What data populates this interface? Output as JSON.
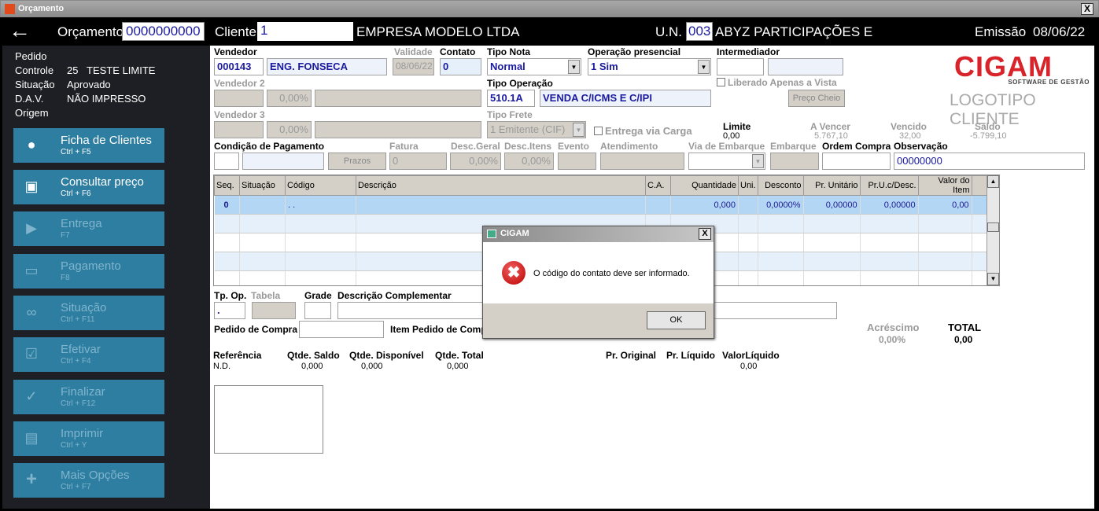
{
  "window": {
    "title": "Orçamento",
    "close": "X"
  },
  "header": {
    "orcamento_label": "Orçamento",
    "orcamento_value": "0000000000",
    "cliente_label": "Cliente",
    "cliente_value": "1",
    "cliente_name": "EMPRESA MODELO LTDA",
    "un_label": "U.N.",
    "un_value": "003",
    "un_name": "ABYZ PARTICIPAÇÕES E",
    "emissao_label": "Emissão",
    "emissao_value": "08/06/22"
  },
  "info": {
    "pedido_label": "Pedido",
    "controle_label": "Controle",
    "controle_value": "25   TESTE LIMITE",
    "situacao_label": "Situação",
    "situacao_value": "Aprovado",
    "dav_label": "D.A.V.",
    "dav_value": "NÃO IMPRESSO",
    "origem_label": "Origem"
  },
  "sidebar": {
    "buttons": [
      {
        "label": "Ficha de Clientes",
        "shortcut": "Ctrl + F5",
        "icon": "users-icon",
        "enabled": true
      },
      {
        "label": "Consultar preço",
        "shortcut": "Ctrl + F6",
        "icon": "price-search-icon",
        "enabled": true
      },
      {
        "label": "Entrega",
        "shortcut": "F7",
        "icon": "truck-icon",
        "enabled": false
      },
      {
        "label": "Pagamento",
        "shortcut": "F8",
        "icon": "money-icon",
        "enabled": false
      },
      {
        "label": "Situação",
        "shortcut": "Ctrl + F11",
        "icon": "link-icon",
        "enabled": false
      },
      {
        "label": "Efetivar",
        "shortcut": "Ctrl + F4",
        "icon": "document-check-icon",
        "enabled": false
      },
      {
        "label": "Finalizar",
        "shortcut": "Ctrl + F12",
        "icon": "checkmark-icon",
        "enabled": false
      },
      {
        "label": "Imprimir",
        "shortcut": "Ctrl + Y",
        "icon": "printer-icon",
        "enabled": false
      },
      {
        "label": "Mais Opções",
        "shortcut": "Ctrl + F7",
        "icon": "plus-icon",
        "enabled": false
      }
    ]
  },
  "form": {
    "vendedor_label": "Vendedor",
    "vendedor_code": "000143",
    "vendedor_name": "ENG. FONSECA",
    "validade_label": "Validade",
    "validade_value": "08/06/22",
    "contato_label": "Contato",
    "contato_value": "0",
    "tipo_nota_label": "Tipo Nota",
    "tipo_nota_value": "Normal",
    "op_presencial_label": "Operação presencial",
    "op_presencial_value": "1 Sim",
    "intermediador_label": "Intermediador",
    "liberado_label": "Liberado Apenas a Vista",
    "preco_cheio": "Preço Cheio",
    "vendedor2_label": "Vendedor 2",
    "vendedor2_pct": "0,00%",
    "vendedor3_label": "Vendedor 3",
    "vendedor3_pct": "0,00%",
    "tipo_operacao_label": "Tipo Operação",
    "tipo_operacao_code": "510.1A",
    "tipo_operacao_desc": "VENDA C/ICMS E C/IPI",
    "tipo_frete_label": "Tipo Frete",
    "tipo_frete_value": "1 Emitente (CIF)",
    "entrega_carga_label": "Entrega via Carga",
    "limite_label": "Limite",
    "limite_value": "0,00",
    "a_vencer_label": "A Vencer",
    "a_vencer_value": "5.767,10",
    "vencido_label": "Vencido",
    "vencido_value": "32,00",
    "saldo_label": "Saldo",
    "saldo_value": "-5.799,10",
    "cond_pag_label": "Condição de Pagamento",
    "prazos": "Prazos",
    "fatura_label": "Fatura",
    "fatura_value": "0",
    "desc_geral_label": "Desc.Geral",
    "desc_geral_value": "0,00%",
    "desc_itens_label": "Desc.Itens",
    "desc_itens_value": "0,00%",
    "evento_label": "Evento",
    "atendimento_label": "Atendimento",
    "via_embarque_label": "Via de Embarque",
    "embarque_label": "Embarque",
    "ordem_compra_label": "Ordem Compra",
    "observacao_label": "Observação",
    "observacao_value": "00000000"
  },
  "logo": {
    "brand": "CIGAM",
    "tagline": "SOFTWARE DE GESTÃO",
    "client_logo": "LOGOTIPO CLIENTE",
    "brand_color": "#d8232a"
  },
  "grid": {
    "columns": [
      "Seq.",
      "Situação",
      "Código",
      "Descrição",
      "C.A.",
      "Quantidade",
      "Uni.",
      "Desconto",
      "Pr. Unitário",
      "Pr.U.c/Desc.",
      "Valor do Item"
    ],
    "rows": [
      [
        "0",
        "",
        ". .",
        "",
        "",
        "0,000",
        "",
        "0,0000%",
        "0,00000",
        "0,00000",
        "0,00"
      ]
    ]
  },
  "bottom": {
    "tp_op_label": "Tp. Op.",
    "tp_op_value": ".",
    "tabela_label": "Tabela",
    "grade_label": "Grade",
    "desc_comp_label": "Descrição Complementar",
    "pedido_compra_label": "Pedido de Compra",
    "item_pedido_label": "Item Pedido de Compra",
    "acrescimo_label": "Acréscimo",
    "acrescimo_value": "0,00%",
    "total_label": "TOTAL",
    "total_value": "0,00",
    "referencia_label": "Referência",
    "referencia_value": "N.D.",
    "qtde_saldo_label": "Qtde. Saldo",
    "qtde_saldo_value": "0,000",
    "qtde_disp_label": "Qtde. Disponível",
    "qtde_disp_value": "0,000",
    "qtde_total_label": "Qtde. Total",
    "qtde_total_value": "0,000",
    "pr_original_label": "Pr. Original",
    "pr_liquido_label": "Pr. Líquido",
    "valor_liquido_label": "ValorLíquido",
    "valor_liquido_value": "0,00"
  },
  "dialog": {
    "title": "CIGAM",
    "close": "X",
    "message": "O código do contato deve ser informado.",
    "ok": "OK",
    "icon": "error-icon"
  }
}
